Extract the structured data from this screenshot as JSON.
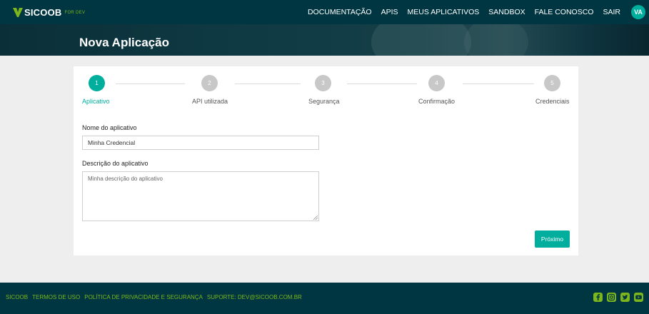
{
  "navbar": {
    "logo_text": "SICOOB",
    "logo_sub": "FOR DEV",
    "links": [
      "DOCUMENTAÇÃO",
      "APIS",
      "MEUS APLICATIVOS",
      "SANDBOX",
      "FALE CONOSCO",
      "SAIR"
    ],
    "avatar": "VA"
  },
  "hero": {
    "title": "Nova Aplicação"
  },
  "stepper": {
    "active_step": 1,
    "steps": [
      {
        "number": "1",
        "label": "Aplicativo"
      },
      {
        "number": "2",
        "label": "API utilizada"
      },
      {
        "number": "3",
        "label": "Segurança"
      },
      {
        "number": "4",
        "label": "Confirmação"
      },
      {
        "number": "5",
        "label": "Credenciais"
      }
    ]
  },
  "form": {
    "name_label": "Nome do aplicativo",
    "name_value": "Minha Credencial",
    "description_label": "Descrição do aplicativo",
    "description_value": "Minha descrição do aplicativo",
    "next_label": "Próximo"
  },
  "footer": {
    "links": [
      "SICOOB",
      "TERMOS DE USO",
      "POLÍTICA DE PRIVACIDADE E SEGURANÇA",
      "SUPORTE: DEV@SICOOB.COM.BR"
    ],
    "social_icons": [
      "facebook-icon",
      "instagram-icon",
      "twitter-icon",
      "youtube-icon"
    ]
  },
  "colors": {
    "primary_dark": "#003641",
    "accent_teal": "#00ae9d",
    "accent_green": "#7db61c",
    "step_inactive": "#c8c8c8"
  }
}
